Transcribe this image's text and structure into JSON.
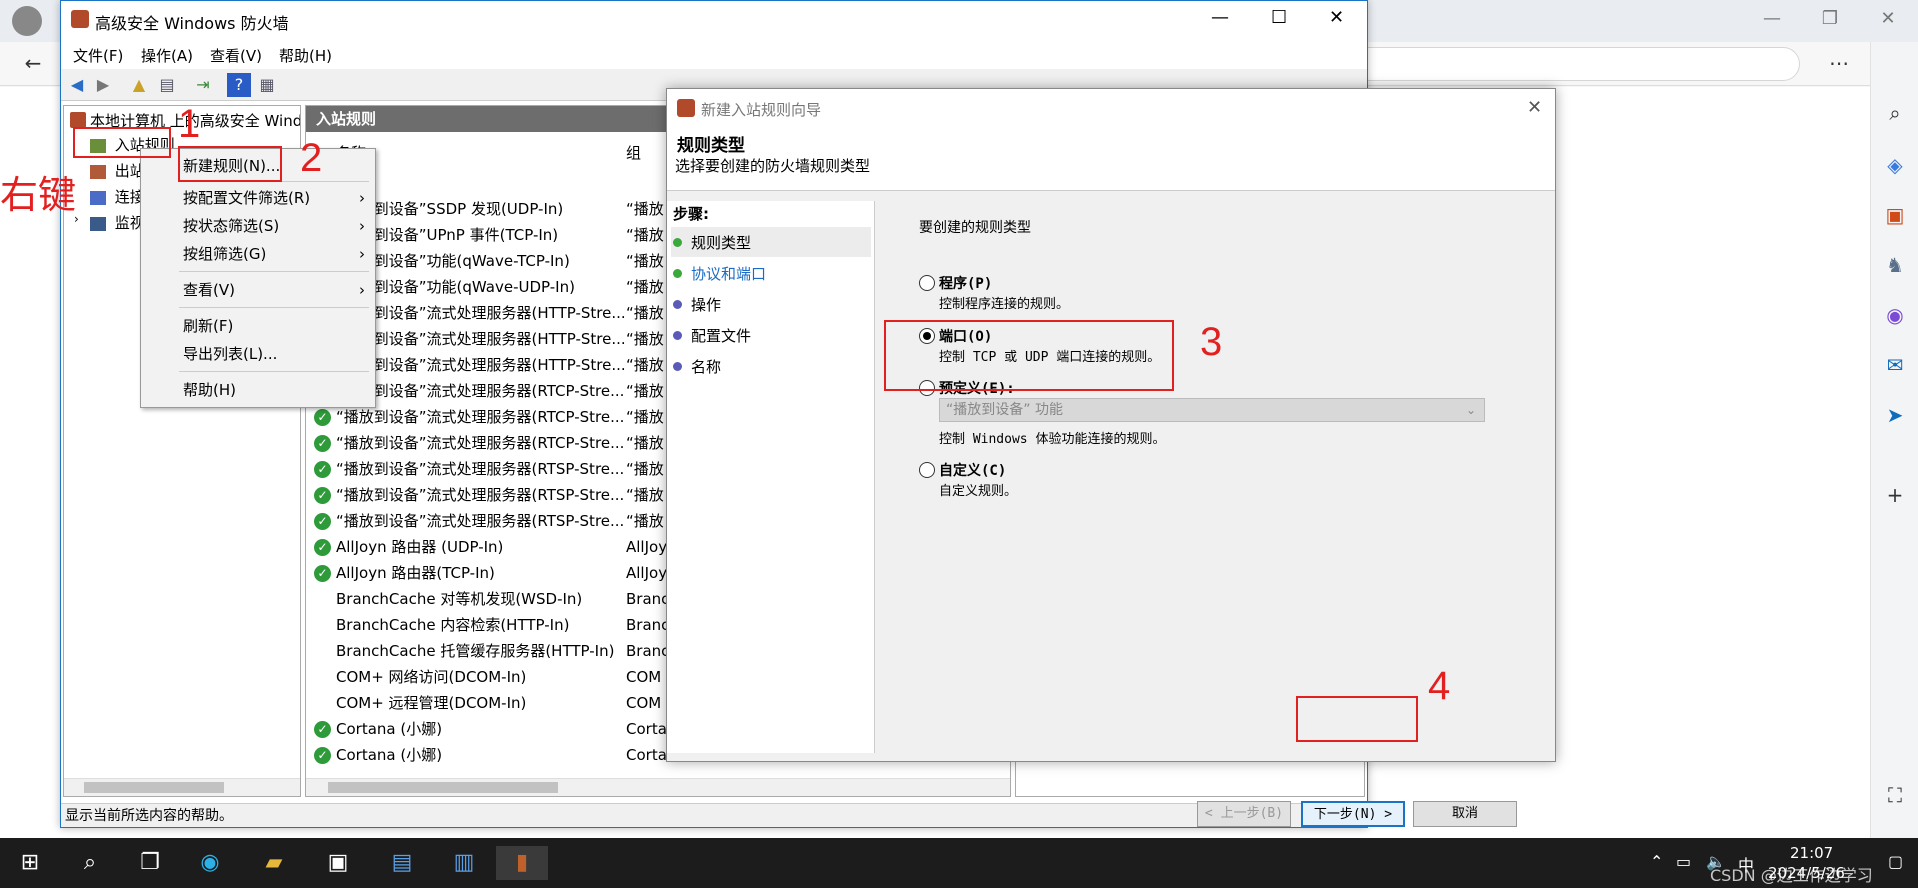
{
  "firewall": {
    "title": "高级安全 Windows 防火墙",
    "menu": [
      "文件(F)",
      "操作(A)",
      "查看(V)",
      "帮助(H)"
    ],
    "tree": {
      "root": "本地计算机 上的高级安全 Windo",
      "items": [
        "入站规则",
        "出站",
        "连接",
        "监视"
      ]
    },
    "list": {
      "header": "入站规则",
      "col_name": "名称",
      "col_group": "组",
      "rows": [
        {
          "name": "“播放到设备”SSDP 发现(UDP-In)",
          "group": "“播放",
          "enabled": true
        },
        {
          "name": "“播放到设备”UPnP 事件(TCP-In)",
          "group": "“播放",
          "enabled": true
        },
        {
          "name": "“播放到设备”功能(qWave-TCP-In)",
          "group": "“播放",
          "enabled": true
        },
        {
          "name": "“播放到设备”功能(qWave-UDP-In)",
          "group": "“播放",
          "enabled": true
        },
        {
          "name": "“播放到设备”流式处理服务器(HTTP-Stre...",
          "group": "“播放",
          "enabled": true
        },
        {
          "name": "“播放到设备”流式处理服务器(HTTP-Stre...",
          "group": "“播放",
          "enabled": true
        },
        {
          "name": "“播放到设备”流式处理服务器(HTTP-Stre...",
          "group": "“播放",
          "enabled": true
        },
        {
          "name": "“播放到设备”流式处理服务器(RTCP-Stre...",
          "group": "“播放",
          "enabled": true
        },
        {
          "name": "“播放到设备”流式处理服务器(RTCP-Stre...",
          "group": "“播放",
          "enabled": true
        },
        {
          "name": "“播放到设备”流式处理服务器(RTCP-Stre...",
          "group": "“播放",
          "enabled": true
        },
        {
          "name": "“播放到设备”流式处理服务器(RTSP-Stre...",
          "group": "“播放",
          "enabled": true
        },
        {
          "name": "“播放到设备”流式处理服务器(RTSP-Stre...",
          "group": "“播放",
          "enabled": true
        },
        {
          "name": "“播放到设备”流式处理服务器(RTSP-Stre...",
          "group": "“播放",
          "enabled": true
        },
        {
          "name": "AllJoyn 路由器 (UDP-In)",
          "group": "AllJoy",
          "enabled": true
        },
        {
          "name": "AllJoyn 路由器(TCP-In)",
          "group": "AllJoy",
          "enabled": true
        },
        {
          "name": "BranchCache 对等机发现(WSD-In)",
          "group": "Branc",
          "enabled": false
        },
        {
          "name": "BranchCache 内容检索(HTTP-In)",
          "group": "Branc",
          "enabled": false
        },
        {
          "name": "BranchCache 托管缓存服务器(HTTP-In)",
          "group": "Branc",
          "enabled": false
        },
        {
          "name": "COM+ 网络访问(DCOM-In)",
          "group": "COM",
          "enabled": false
        },
        {
          "name": "COM+ 远程管理(DCOM-In)",
          "group": "COM",
          "enabled": false
        },
        {
          "name": "Cortana (小娜)",
          "group": "Corta",
          "enabled": true
        },
        {
          "name": "Cortana (小娜)",
          "group": "Cortana (小娜)",
          "enabled": true
        }
      ]
    },
    "status": "显示当前所选内容的帮助。"
  },
  "context_menu": {
    "items": [
      {
        "label": "新建规则(N)...",
        "submenu": false
      },
      {
        "label": "按配置文件筛选(R)",
        "submenu": true
      },
      {
        "label": "按状态筛选(S)",
        "submenu": true
      },
      {
        "label": "按组筛选(G)",
        "submenu": true
      },
      {
        "label": "查看(V)",
        "submenu": true
      },
      {
        "label": "刷新(F)",
        "submenu": false
      },
      {
        "label": "导出列表(L)...",
        "submenu": false
      },
      {
        "label": "帮助(H)",
        "submenu": false
      }
    ]
  },
  "wizard": {
    "title": "新建入站规则向导",
    "heading": "规则类型",
    "subheading": "选择要创建的防火墙规则类型",
    "steps_label": "步骤:",
    "steps": [
      {
        "label": "规则类型",
        "color": "#3aa83a"
      },
      {
        "label": "协议和端口",
        "color": "#3aa83a"
      },
      {
        "label": "操作",
        "color": "#5a5ab8"
      },
      {
        "label": "配置文件",
        "color": "#5a5ab8"
      },
      {
        "label": "名称",
        "color": "#5a5ab8"
      }
    ],
    "question": "要创建的规则类型",
    "options": [
      {
        "label": "程序(P)",
        "desc": "控制程序连接的规则。",
        "selected": false
      },
      {
        "label": "端口(O)",
        "desc": "控制 TCP 或 UDP 端口连接的规则。",
        "selected": true
      },
      {
        "label": "预定义(E):",
        "desc": "控制 Windows 体验功能连接的规则。",
        "selected": false
      },
      {
        "label": "自定义(C)",
        "desc": "自定义规则。",
        "selected": false
      }
    ],
    "predefined_select": "“播放到设备” 功能",
    "buttons": {
      "back": "< 上一步(B)",
      "next": "下一步(N) >",
      "cancel": "取消"
    }
  },
  "annotations": {
    "right_click": "右键",
    "n1": "1",
    "n2": "2",
    "n3": "3",
    "n4": "4"
  },
  "taskbar": {
    "time": "21:07",
    "date": "2024/5/26",
    "watermark": "CSDN @边工作边学习"
  },
  "colors": {
    "accent": "#1a73c6",
    "annotation": "#e32020"
  }
}
